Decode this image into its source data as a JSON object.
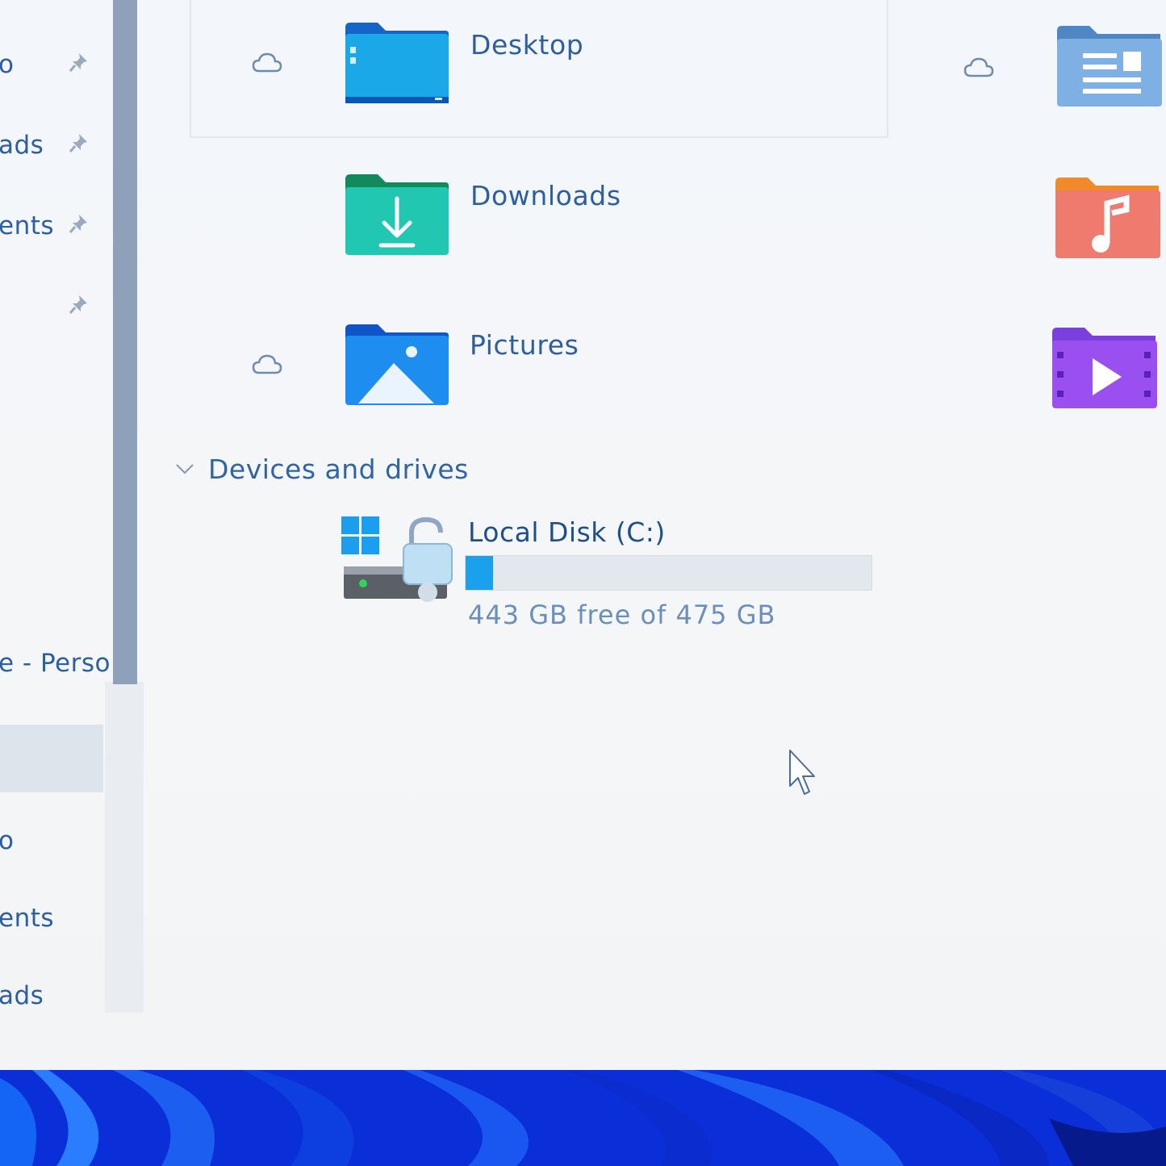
{
  "nav": {
    "items": [
      {
        "label": "o",
        "pinned": true
      },
      {
        "label": "ads",
        "pinned": true
      },
      {
        "label": "ents",
        "pinned": true
      },
      {
        "label": "",
        "pinned": true
      },
      {
        "label": "e - Perso",
        "pinned": false
      },
      {
        "label": "o",
        "pinned": false
      },
      {
        "label": "ents",
        "pinned": false
      },
      {
        "label": "ads",
        "pinned": false
      }
    ]
  },
  "quick_access": {
    "folders": [
      {
        "name": "Desktop",
        "icon": "desktop-folder-icon",
        "cloud": true
      },
      {
        "name": "Downloads",
        "icon": "downloads-folder-icon",
        "cloud": false
      },
      {
        "name": "Pictures",
        "icon": "pictures-folder-icon",
        "cloud": true
      }
    ],
    "right_column": [
      {
        "icon": "documents-folder-icon",
        "cloud": true
      },
      {
        "icon": "music-folder-icon",
        "cloud": false
      },
      {
        "icon": "videos-folder-icon",
        "cloud": false
      }
    ]
  },
  "devices": {
    "section_title": "Devices and drives",
    "drives": [
      {
        "name": "Local Disk (C:)",
        "free_text": "443 GB free of 475 GB",
        "used_fraction": 0.067,
        "bar_color": "#1aa0ec"
      }
    ]
  },
  "colors": {
    "accent": "#1aa0ec",
    "text": "#2d5e9f",
    "wallpaper": "#0b2fd6"
  }
}
